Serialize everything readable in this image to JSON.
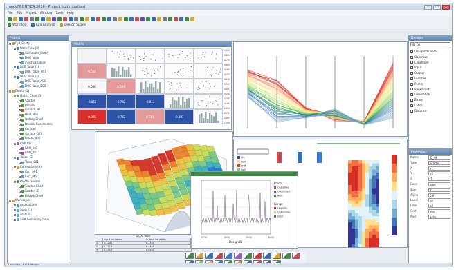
{
  "window": {
    "title": "modeFRONTIER 2016 - Project (optimization)"
  },
  "menu": [
    "File",
    "Edit",
    "Project",
    "Window",
    "Tools",
    "Help"
  ],
  "toolbar2": {
    "items": [
      {
        "label": "Workflow",
        "color": "#3b8a3e"
      },
      {
        "label": "Run Analysis",
        "color": "#2f6fb3"
      },
      {
        "label": "Design Space",
        "color": "#c8a431"
      }
    ]
  },
  "tree": {
    "header": "Project",
    "rows": [
      {
        "label": "Opt_Study",
        "color": "#e0a030",
        "indent": 0
      },
      {
        "label": "Work Flow (8)",
        "color": "#3a7bd5",
        "indent": 1
      },
      {
        "label": "Calculator_Node",
        "color": "#5aa0d0",
        "indent": 2
      },
      {
        "label": "DOE Table",
        "color": "#5aa0d0",
        "indent": 2
      },
      {
        "label": "Input variables",
        "color": "#5aa0d0",
        "indent": 2
      },
      {
        "label": "DOE Table (1)",
        "color": "#3a7bd5",
        "indent": 1
      },
      {
        "label": "DOE_Table_001",
        "color": "#5aa0d0",
        "indent": 2
      },
      {
        "label": "DOE Table (2)",
        "color": "#3a7bd5",
        "indent": 1
      },
      {
        "label": "DOE Table_A00",
        "color": "#5aa0d0",
        "indent": 2
      },
      {
        "label": "DOE Table_B00",
        "color": "#5aa0d0",
        "indent": 2
      },
      {
        "label": "Charts (5)",
        "color": "#e0a030",
        "indent": 0
      },
      {
        "label": "Matrix Chart (1)",
        "color": "#4a9a48",
        "indent": 1
      },
      {
        "label": "Scatter",
        "color": "#4a9a48",
        "indent": 2
      },
      {
        "label": "Parallel",
        "color": "#4a9a48",
        "indent": 2
      },
      {
        "label": "Surface 3D",
        "color": "#c84a4a",
        "indent": 2
      },
      {
        "label": "Heat Map",
        "color": "#4a9a48",
        "indent": 2
      },
      {
        "label": "History Chart",
        "color": "#4a9a48",
        "indent": 2
      },
      {
        "label": "Parallel Coordinates",
        "color": "#4a9a48",
        "indent": 2
      },
      {
        "label": "Contour",
        "color": "#4a9a48",
        "indent": 2
      },
      {
        "label": "Surface_001",
        "color": "#4a9a48",
        "indent": 2
      },
      {
        "label": "Pareto_001",
        "color": "#4a9a48",
        "indent": 2
      },
      {
        "label": "RSM (3)",
        "color": "#9a5ac0",
        "indent": 1
      },
      {
        "label": "RSM_001",
        "color": "#9a5ac0",
        "indent": 2
      },
      {
        "label": "RSM_002",
        "color": "#9a5ac0",
        "indent": 2
      },
      {
        "label": "Tables (2)",
        "color": "#3a7bd5",
        "indent": 1
      },
      {
        "label": "Table_001",
        "color": "#5aa0d0",
        "indent": 2
      },
      {
        "label": "Correlations (4)",
        "color": "#e0a030",
        "indent": 1
      },
      {
        "label": "Corr_001",
        "color": "#5aa0d0",
        "indent": 2
      },
      {
        "label": "Corr_002",
        "color": "#5aa0d0",
        "indent": 2
      },
      {
        "label": "Pareto Frontier",
        "color": "#4a9a48",
        "indent": 1
      },
      {
        "label": "Scatter Chart",
        "color": "#4a9a48",
        "indent": 2
      },
      {
        "label": "Scatter 3D",
        "color": "#4a9a48",
        "indent": 2
      },
      {
        "label": "Bubble Chart",
        "color": "#4a9a48",
        "indent": 2
      },
      {
        "label": "Workspace",
        "color": "#e0a030",
        "indent": 0
      },
      {
        "label": "Associations",
        "color": "#5aa0d0",
        "indent": 1
      },
      {
        "label": "Stats (1)",
        "color": "#5aa0d0",
        "indent": 1
      },
      {
        "label": "Stats 2",
        "color": "#5aa0d0",
        "indent": 1
      },
      {
        "label": "SSM Sensitivity Table",
        "color": "#5aa0d0",
        "indent": 1
      }
    ]
  },
  "rpanel": {
    "header": "Designs",
    "search": "ID_00",
    "items": [
      "Design/Variables",
      "Objective",
      "Constraint",
      "Input",
      "Output",
      "Feasible",
      "Pareto",
      "Rank/Front",
      "Generation",
      "Errors",
      "Label",
      "Distance"
    ]
  },
  "props": {
    "header": "Properties",
    "rows": [
      {
        "k": "Name",
        "v": "ID_00"
      },
      {
        "k": "Type",
        "v": "Scatter"
      },
      {
        "k": "X",
        "v": "x1"
      },
      {
        "k": "Y",
        "v": "y2"
      },
      {
        "k": "Z",
        "v": "f1"
      },
      {
        "k": "Color",
        "v": "blue"
      },
      {
        "k": "Size",
        "v": "2"
      },
      {
        "k": "Alpha",
        "v": "0.6"
      },
      {
        "k": "Label",
        "v": "on"
      },
      {
        "k": "Filter",
        "v": "all"
      },
      {
        "k": "Grid",
        "v": "yes"
      },
      {
        "k": "Axis",
        "v": "auto"
      }
    ]
  },
  "matrix": {
    "header": "Matrix",
    "labels": [
      "in",
      "var_opt",
      "out_res"
    ],
    "cells": [
      {
        "r": 0,
        "c": 0,
        "label": "",
        "bg": "#f4f4f4"
      },
      {
        "r": 1,
        "c": 0,
        "label": "0.654",
        "bg": "#e59a9a"
      },
      {
        "r": 2,
        "c": 0,
        "label": "0.036",
        "bg": "#f7f7f7"
      },
      {
        "r": 2,
        "c": 1,
        "label": "0.684",
        "bg": "#e59a9a"
      },
      {
        "r": 3,
        "c": 0,
        "label": "-0.851",
        "bg": "#2d54a8"
      },
      {
        "r": 3,
        "c": 1,
        "label": "-0.742",
        "bg": "#2d54a8"
      },
      {
        "r": 3,
        "c": 2,
        "label": "-0.813",
        "bg": "#2d54a8"
      },
      {
        "r": 4,
        "c": 0,
        "label": "0.935",
        "bg": "#d9302c"
      },
      {
        "r": 4,
        "c": 1,
        "label": "-0.762",
        "bg": "#2d54a8"
      },
      {
        "r": 4,
        "c": 2,
        "label": "0.561",
        "bg": "#e59a9a"
      },
      {
        "r": 4,
        "c": 3,
        "label": "-0.801",
        "bg": "#2d54a8"
      }
    ],
    "scale": [
      "1.000",
      "0.867",
      "0.733",
      "0.600",
      "0.467",
      "0.333",
      "0.200",
      "0.067",
      "-0.067",
      "-0.200",
      "-0.333",
      "-0.467",
      "-0.600",
      "-0.733",
      "-0.867",
      "-1.000"
    ]
  },
  "heat": {
    "legend": [
      "in",
      "var",
      "out",
      "sel"
    ]
  },
  "line": {
    "legend_a": "Points",
    "legend_b": "Range",
    "items_a": [
      "Objective",
      "Constraint",
      "Best"
    ],
    "items_b": [
      "Feasible",
      "Unfeasible",
      "Error"
    ],
    "ticks": [
      "0.00",
      "1000",
      "2000",
      "3000"
    ],
    "xlabel": "Design ID"
  },
  "dtable": {
    "caption": "ID_00 Table",
    "headers": [
      "",
      "Input Variables",
      "Output Variables"
    ],
    "rows": [
      [
        "1",
        "0.1245",
        "0.3351"
      ],
      [
        "2",
        "0.2218",
        "0.4465"
      ],
      [
        "3",
        "0.3319",
        "0.5582"
      ]
    ]
  },
  "status": "5 selected / 1 of 4 designs"
}
